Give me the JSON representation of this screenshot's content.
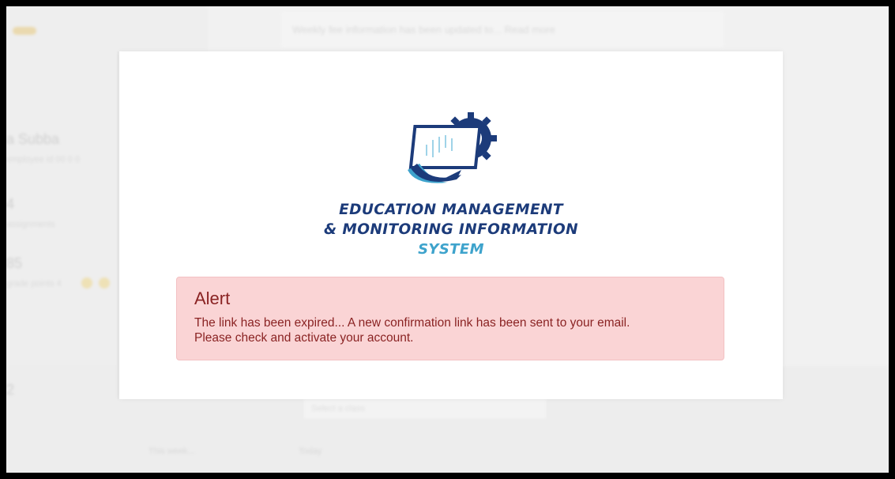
{
  "background": {
    "topbar_text": "Weekly fee information has been updated to... Read more",
    "user_name": "a Subba",
    "user_sub": "employee id 00 0 0",
    "stat1": "4",
    "stat1_sub": "assignments",
    "stat2": "85",
    "stat2_sub": "grade points 4",
    "stat3": "2",
    "input_placeholder": "Select a class",
    "bottom_left": "This week...",
    "bottom_mid": "Today"
  },
  "logo": {
    "line1": "EDUCATION  MANAGEMENT",
    "line2": "& MONITORING INFORMATION",
    "line3": "SYSTEM",
    "colors": {
      "primary": "#1c3b7a",
      "accent": "#3ea3cc"
    },
    "icon": "monitor-gear-logo"
  },
  "alert": {
    "title": "Alert",
    "message_line1": "The link has been expired... A new confirmation link has been sent to your email.",
    "message_line2": "Please check and activate your account.",
    "colors": {
      "background": "#fad4d5",
      "text": "#8a2323"
    }
  }
}
